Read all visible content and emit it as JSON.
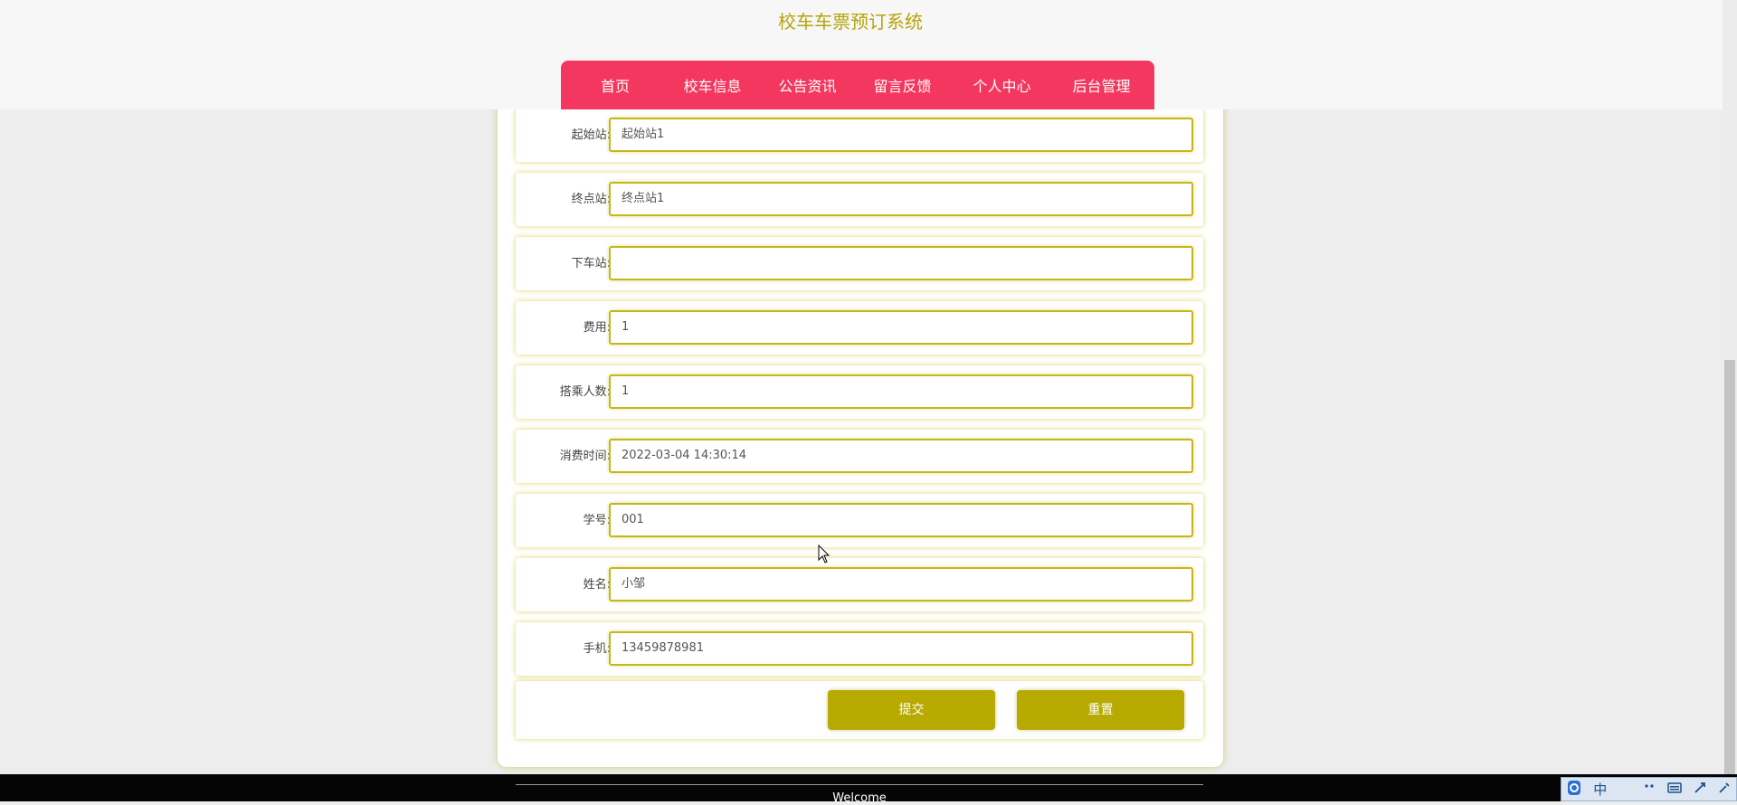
{
  "header": {
    "title": "校车车票预订系统",
    "nav": [
      "首页",
      "校车信息",
      "公告资讯",
      "留言反馈",
      "个人中心",
      "后台管理"
    ]
  },
  "form": {
    "fields": [
      {
        "label": "起始站:",
        "value": "起始站1"
      },
      {
        "label": "终点站:",
        "value": "终点站1"
      },
      {
        "label": "下车站:",
        "value": ""
      },
      {
        "label": "费用:",
        "value": "1"
      },
      {
        "label": "搭乘人数:",
        "value": "1"
      },
      {
        "label": "消费时间:",
        "value": "2022-03-04 14:30:14"
      },
      {
        "label": "学号:",
        "value": "001"
      },
      {
        "label": "姓名:",
        "value": "小邹"
      },
      {
        "label": "手机:",
        "value": "13459878981"
      }
    ],
    "submit_label": "提交",
    "reset_label": "重置"
  },
  "footer": {
    "text": "Welcome"
  },
  "ime": {
    "icons": [
      "ime-logo-icon",
      "chinese-mode-icon",
      "half-width-icon",
      "punctuation-icon",
      "keyboard-icon",
      "tools-icon",
      "settings-icon"
    ],
    "mode_label": "中"
  },
  "colors": {
    "accent": "#b7aa00",
    "nav": "#f3375e",
    "title": "#b5a40a"
  }
}
